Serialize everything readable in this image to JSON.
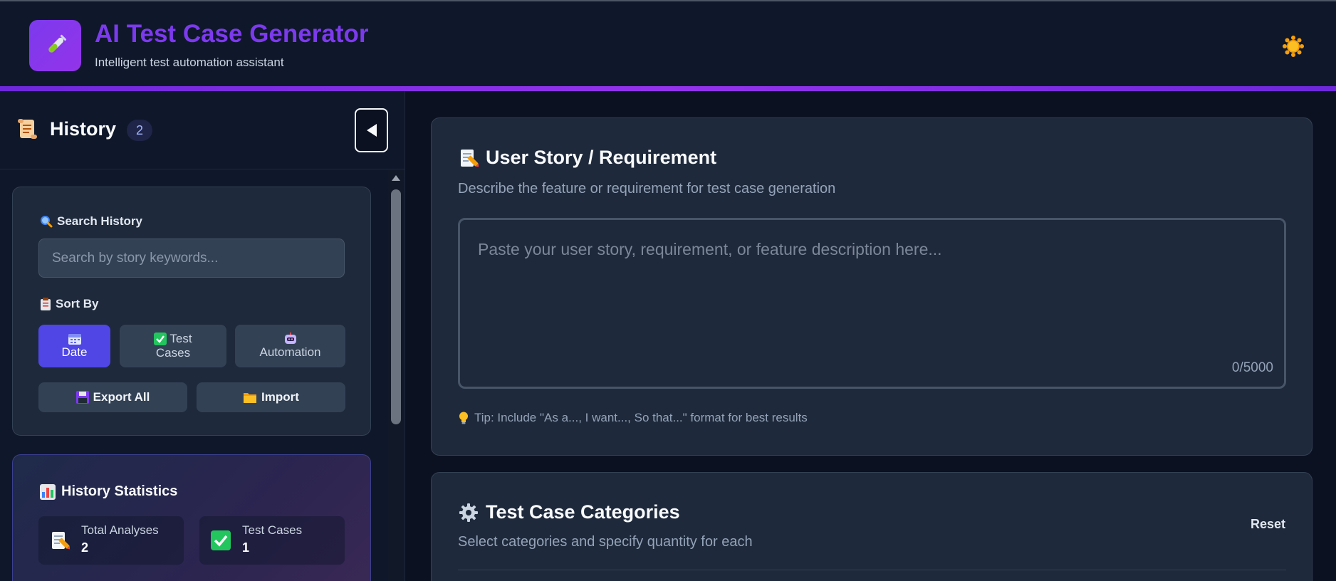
{
  "header": {
    "title": "AI Test Case Generator",
    "subtitle": "Intelligent test automation assistant",
    "logo_icon": "test-tube-icon",
    "theme_icon": "sun-icon"
  },
  "sidebar": {
    "title": "History",
    "count": "2",
    "filters": {
      "search_label": "Search History",
      "search_placeholder": "Search by story keywords...",
      "sort_label": "Sort By",
      "sort_options": [
        {
          "icon": "calendar-icon",
          "line1": "",
          "line2": "Date",
          "active": true
        },
        {
          "icon": "check-box-icon",
          "line1": "Test",
          "line2": "Cases",
          "active": false
        },
        {
          "icon": "robot-icon",
          "line1": "",
          "line2": "Automation",
          "active": false
        }
      ],
      "export_label": "Export All",
      "import_label": "Import"
    },
    "stats": {
      "title": "History Statistics",
      "items": [
        {
          "label": "Total Analyses",
          "value": "2",
          "icon": "memo-icon"
        },
        {
          "label": "Test Cases",
          "value": "1",
          "icon": "check-box-icon"
        }
      ]
    }
  },
  "main": {
    "story_card": {
      "title": "User Story / Requirement",
      "subtitle": "Describe the feature or requirement for test case generation",
      "placeholder": "Paste your user story, requirement, or feature description here...",
      "char_count": "0/5000",
      "tip": "Tip: Include \"As a..., I want..., So that...\" format for best results"
    },
    "categories_card": {
      "title": "Test Case Categories",
      "subtitle": "Select categories and specify quantity for each",
      "reset_label": "Reset"
    }
  },
  "colors": {
    "accent": "#7c3aed",
    "active_button": "#4f46e5",
    "background": "#0b1120",
    "card": "#1e293b"
  }
}
